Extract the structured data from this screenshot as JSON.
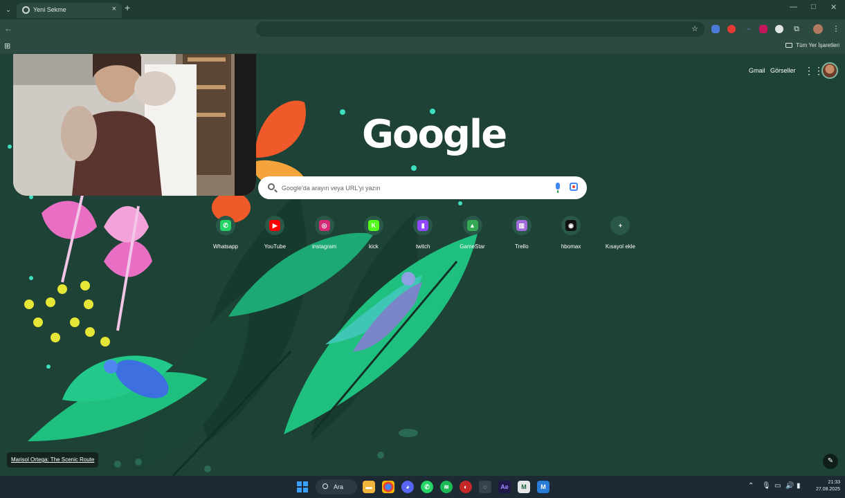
{
  "window": {
    "tab_title": "Yeni Sekme",
    "min_glyph": "—",
    "max_glyph": "□",
    "close_glyph": "✕"
  },
  "bookmarks": {
    "all_bookmarks_label": "Tüm Yer İşaretleri"
  },
  "ntp": {
    "header_links": {
      "gmail": "Gmail",
      "images": "Görseller"
    },
    "logo_text": "Google",
    "search": {
      "placeholder": "Google'da arayın veya URL'yi yazın"
    },
    "shortcuts": [
      {
        "label": "Whatsapp",
        "glyph": "✆",
        "icon": "whatsapp-icon",
        "color": "#25d366"
      },
      {
        "label": "YouTube",
        "glyph": "▶",
        "icon": "youtube-icon",
        "color": "#ff0000"
      },
      {
        "label": "instagram",
        "glyph": "◎",
        "icon": "instagram-icon",
        "color": "#d62976"
      },
      {
        "label": "kick",
        "glyph": "K",
        "icon": "kick-icon",
        "color": "#53fc18"
      },
      {
        "label": "twitch",
        "glyph": "▮",
        "icon": "twitch-icon",
        "color": "#9146ff"
      },
      {
        "label": "GameStar",
        "glyph": "▲",
        "icon": "gamestar-icon",
        "color": "#34a853"
      },
      {
        "label": "Trello",
        "glyph": "▥",
        "icon": "trello-icon",
        "color": "#a06bd9"
      },
      {
        "label": "hbomax",
        "glyph": "◉",
        "icon": "hbomax-icon",
        "color": "#111111"
      },
      {
        "label": "Kısayol ekle",
        "glyph": "+",
        "icon": "add-shortcut-icon",
        "color": "#2a5848"
      }
    ],
    "background_credit": "Marisol Ortega: The Scenic Route"
  },
  "taskbar": {
    "search_label": "Ara",
    "time": "21:33",
    "date": "27.08.2025"
  },
  "colors": {
    "background": "#1f4236",
    "toolbar": "#2c4a3f",
    "taskbar": "#1d2a33",
    "leaf_green": "#1fbf7f",
    "flower_pink": "#e86fc4"
  }
}
